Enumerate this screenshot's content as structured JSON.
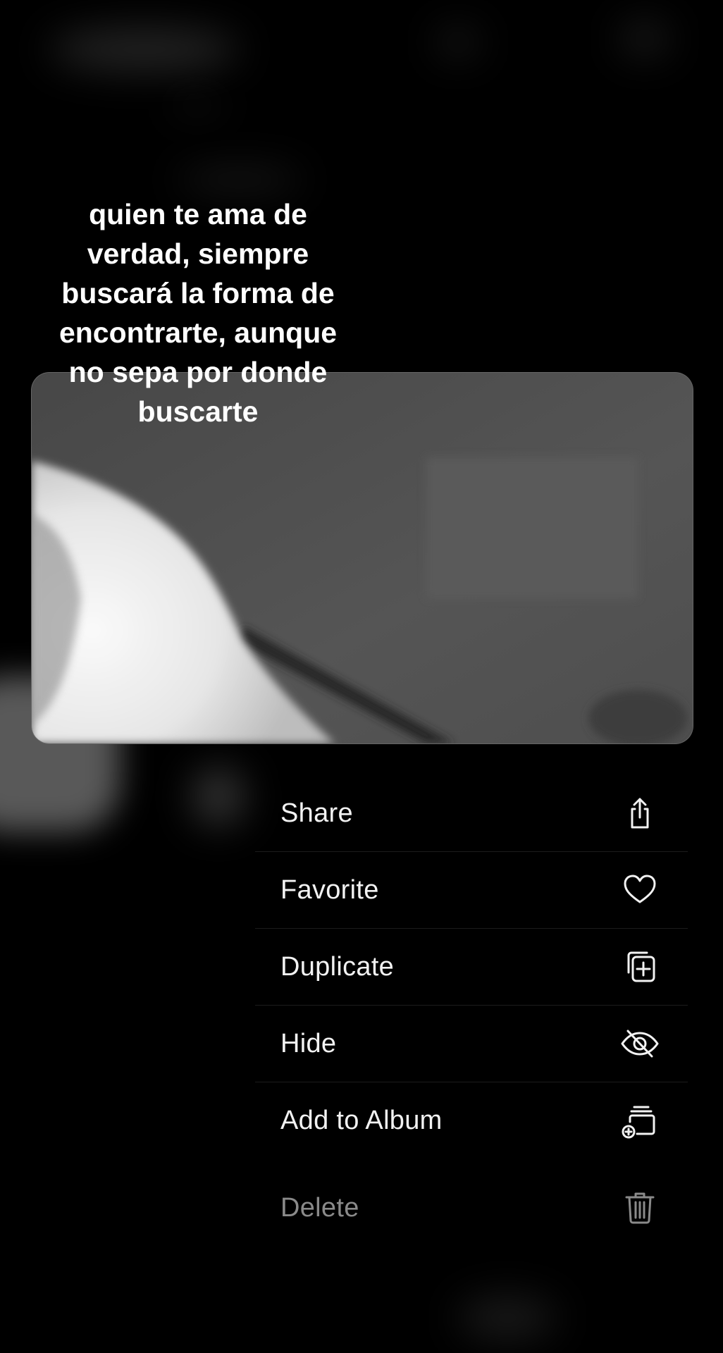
{
  "story": {
    "caption": "quien te ama de\nverdad, siempre\nbuscará la forma de\nencontrarte, aunque\nno sepa  por donde\nbuscarte"
  },
  "context_menu": {
    "items": [
      {
        "label": "Share",
        "icon": "share-icon"
      },
      {
        "label": "Favorite",
        "icon": "heart-icon"
      },
      {
        "label": "Duplicate",
        "icon": "duplicate-icon"
      },
      {
        "label": "Hide",
        "icon": "eye-slash-icon"
      },
      {
        "label": "Add to Album",
        "icon": "add-to-album-icon"
      },
      {
        "label": "Delete",
        "icon": "trash-icon",
        "destructive_dimmed": true
      }
    ]
  },
  "colors": {
    "background": "#000000",
    "menu_text": "#f2f2f2",
    "delete_text": "#8a8a8a",
    "photo_base": "#515151"
  }
}
